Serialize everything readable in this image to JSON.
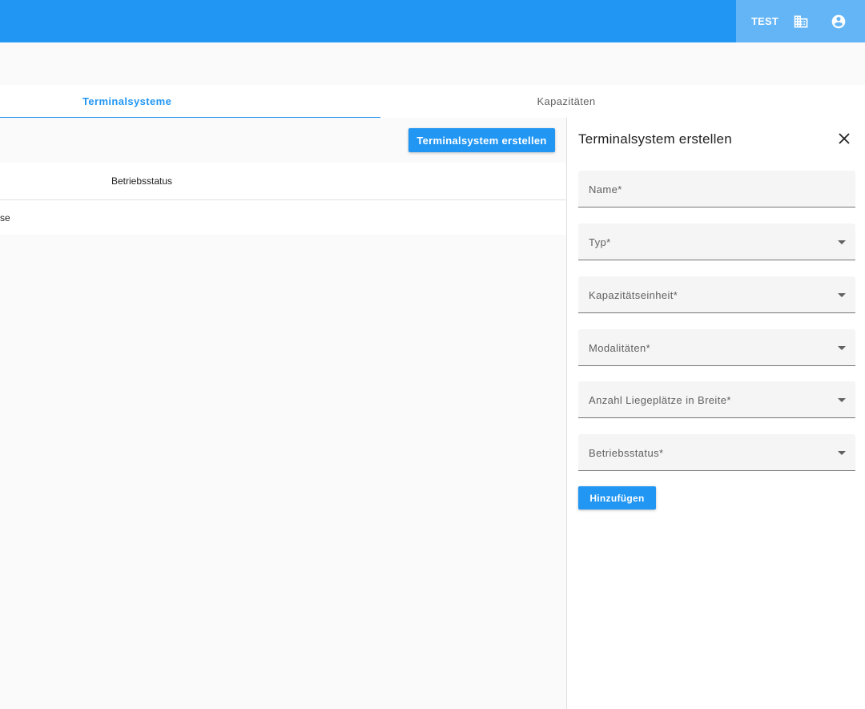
{
  "header": {
    "env_label": "TEST",
    "icons": [
      "building-icon",
      "account-circle-icon"
    ]
  },
  "tabs": [
    {
      "label": "Terminalsysteme",
      "active": true
    },
    {
      "label": "Kapazitäten",
      "active": false
    }
  ],
  "main": {
    "create_button": "Terminalsystem erstellen",
    "table": {
      "columns": [
        "Betriebsstatus"
      ],
      "rows": [
        [
          "se"
        ]
      ]
    }
  },
  "panel": {
    "title": "Terminalsystem erstellen",
    "close_icon": "close-icon",
    "fields": [
      {
        "label": "Name*",
        "type": "text"
      },
      {
        "label": "Typ*",
        "type": "select"
      },
      {
        "label": "Kapazitätseinheit*",
        "type": "select"
      },
      {
        "label": "Modalitäten*",
        "type": "select"
      },
      {
        "label": "Anzahl Liegeplätze in Breite*",
        "type": "select"
      },
      {
        "label": "Betriebsstatus*",
        "type": "select"
      }
    ],
    "submit_button": "Hinzufügen"
  },
  "colors": {
    "primary": "#2196f3",
    "header_accent": "#64b5f6"
  }
}
